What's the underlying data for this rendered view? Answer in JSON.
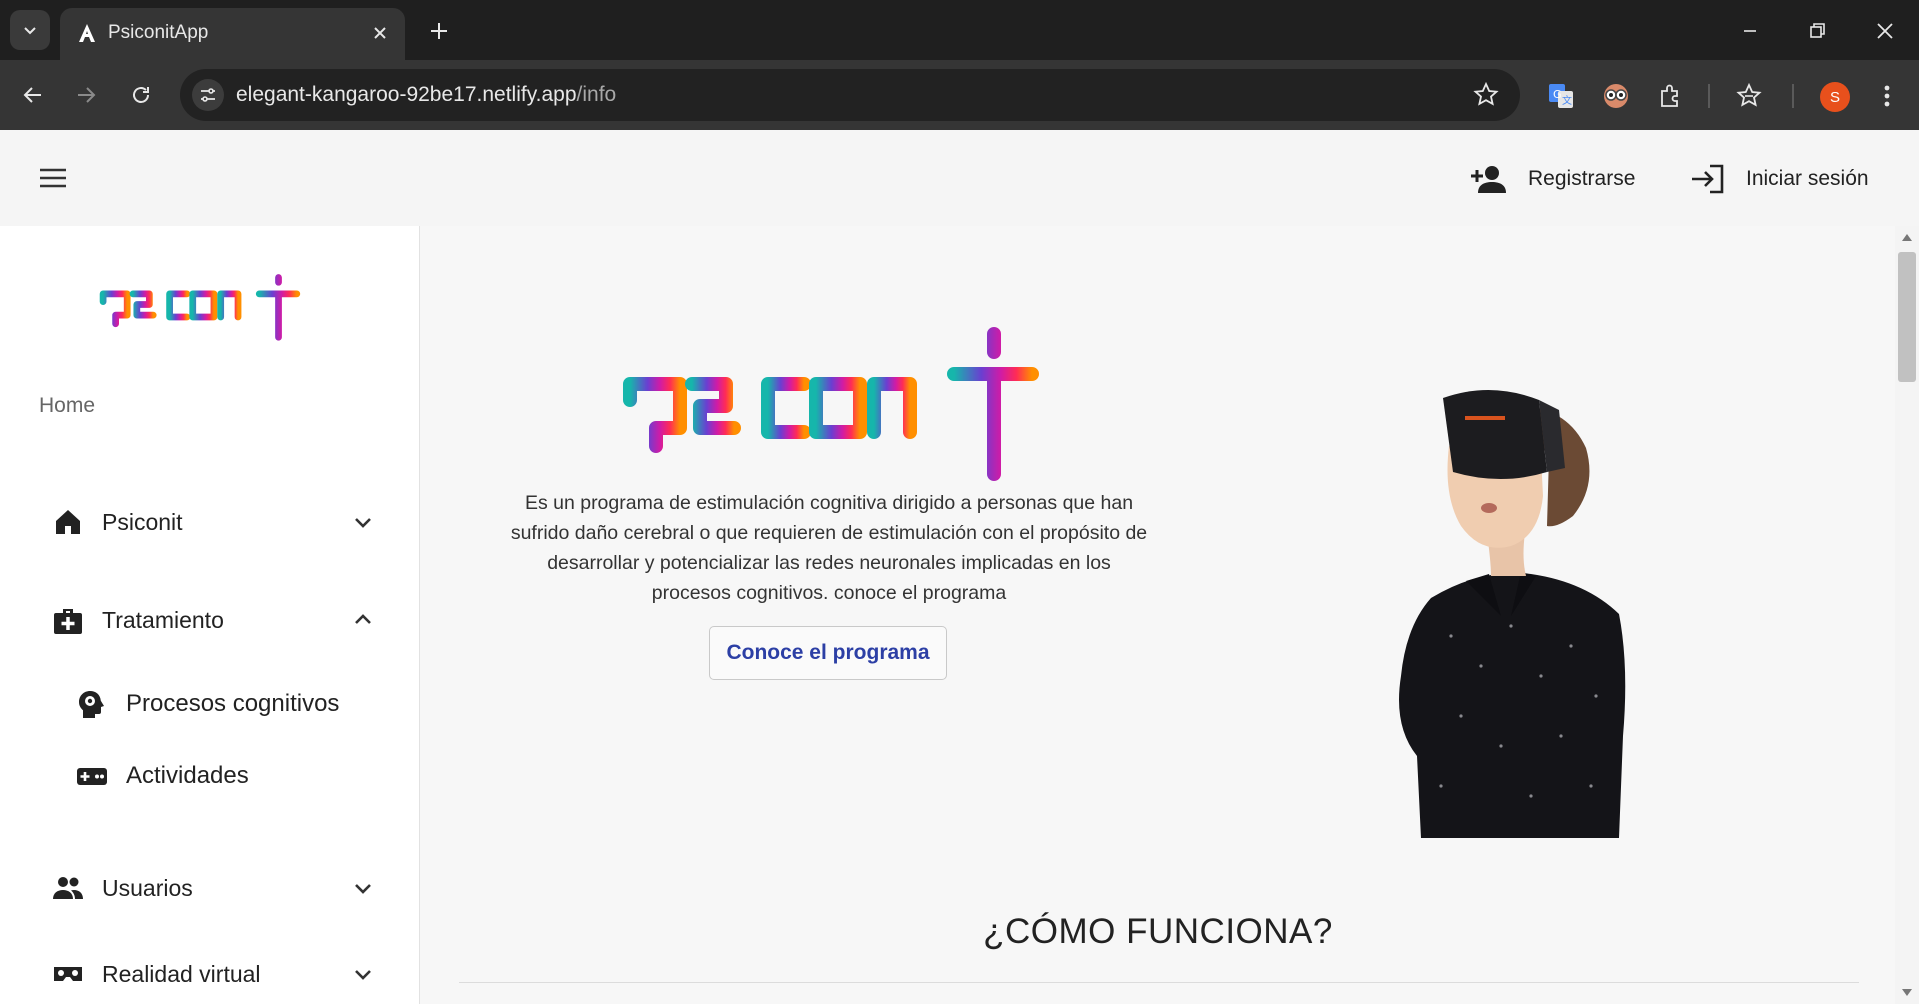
{
  "browser": {
    "tab_title": "PsiconitApp",
    "url_host": "elegant-kangaroo-92be17.netlify.app",
    "url_path": "/info",
    "profile_initial": "S",
    "profile_color": "#e8501c"
  },
  "header": {
    "register_label": "Registrarse",
    "login_label": "Iniciar sesión"
  },
  "sidebar": {
    "logo_text": "psiconit",
    "home_label": "Home",
    "items": [
      {
        "label": "Psiconit",
        "icon": "home-icon",
        "expanded": false
      },
      {
        "label": "Tratamiento",
        "icon": "medical-bag-icon",
        "expanded": true
      },
      {
        "label": "Procesos cognitivos",
        "icon": "head-gear-icon"
      },
      {
        "label": "Actividades",
        "icon": "gamepad-icon"
      },
      {
        "label": "Usuarios",
        "icon": "people-icon",
        "expanded": false
      },
      {
        "label": "Realidad virtual",
        "icon": "vr-headset-icon",
        "expanded": false
      }
    ]
  },
  "main": {
    "logo_text": "psiconit",
    "description": "Es un programa de estimulación cognitiva dirigido a personas que han sufrido daño cerebral o que requieren de estimulación con el propósito de desarrollar y potencializar las redes neuronales implicadas en los procesos cognitivos. conoce el programa",
    "cta_label": "Conoce el programa",
    "section_title": "¿CÓMO FUNCIONA?"
  },
  "colors": {
    "accent_blue": "#2c3fa5",
    "logo_gradient": [
      "#1bb5b0",
      "#6a3fd1",
      "#c219a8",
      "#ff2c55",
      "#ff8a00"
    ]
  }
}
